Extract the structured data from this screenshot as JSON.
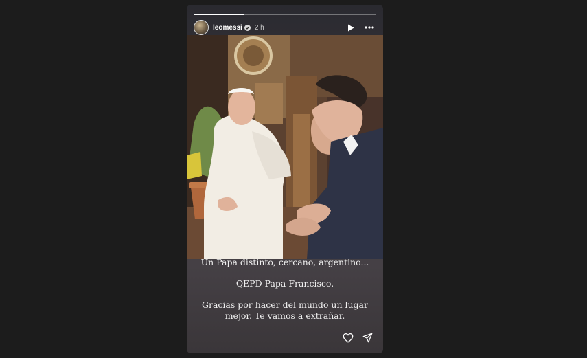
{
  "story": {
    "username": "leomessi",
    "time_ago": "2 h",
    "progress": 0.28,
    "icons": {
      "avatar": "profile-avatar",
      "verified": "verified-badge-icon",
      "play": "play-icon",
      "more": "more-icon",
      "like": "heart-icon",
      "share": "send-icon"
    },
    "caption": {
      "line1": "Un Papa distinto, cercano, argentino...",
      "line2": "QEPD Papa Francisco.",
      "line3a": "Gracias por hacer del mundo un lugar",
      "line3b": "mejor. Te vamos a extrañar."
    }
  },
  "colors": {
    "page_background": "#1c1c1c",
    "text": "#ffffff"
  }
}
